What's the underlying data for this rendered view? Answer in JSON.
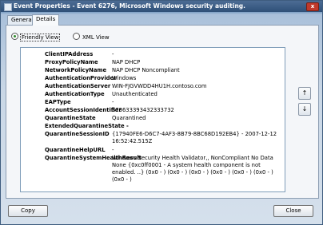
{
  "window": {
    "title": "Event Properties - Event 6276, Microsoft Windows security auditing.",
    "close_glyph": "x"
  },
  "tabs": [
    {
      "label": "General"
    },
    {
      "label": "Details"
    }
  ],
  "views": {
    "friendly_label": "Friendly View",
    "xml_label": "XML View",
    "selected": "Friendly View"
  },
  "details": [
    {
      "key": "ClientIPAddress",
      "value": "-"
    },
    {
      "key": "ProxyPolicyName",
      "value": "NAP DHCP"
    },
    {
      "key": "NetworkPolicyName",
      "value": "NAP DHCP Noncompliant"
    },
    {
      "key": "AuthenticationProvider",
      "value": "Windows"
    },
    {
      "key": "AuthenticationServer",
      "value": "WIN-FJGVWDD4HU1H.contoso.com"
    },
    {
      "key": "AuthenticationType",
      "value": "Unauthenticated"
    },
    {
      "key": "EAPType",
      "value": "-"
    },
    {
      "key": "AccountSessionIdentifier",
      "value": "373633393432333732"
    },
    {
      "key": "QuarantineState",
      "value": "Quarantined"
    },
    {
      "key": "ExtendedQuarantineState -",
      "value": ""
    },
    {
      "key": "QuarantineSessionID",
      "value": "{17940FE6-D6C7-4AF3-8B79-8BC68D192EB4} - 2007-12-12 16:52:42.515Z"
    },
    {
      "key": "QuarantineHelpURL",
      "value": "-"
    },
    {
      "key": "QuarantineSystemHealthResult",
      "value": "Windows Security Health Validator,, NonCompliant No Data None {0xc0ff0001 - A system health component is not enabled. ..} (0x0 - ) (0x0 - ) (0x0 - ) (0x0 - ) (0x0 - ) (0x0 - ) (0x0 - )"
    }
  ],
  "side_buttons": {
    "up": "↑",
    "down": "↓"
  },
  "buttons": {
    "copy": "Copy",
    "close": "Close"
  }
}
